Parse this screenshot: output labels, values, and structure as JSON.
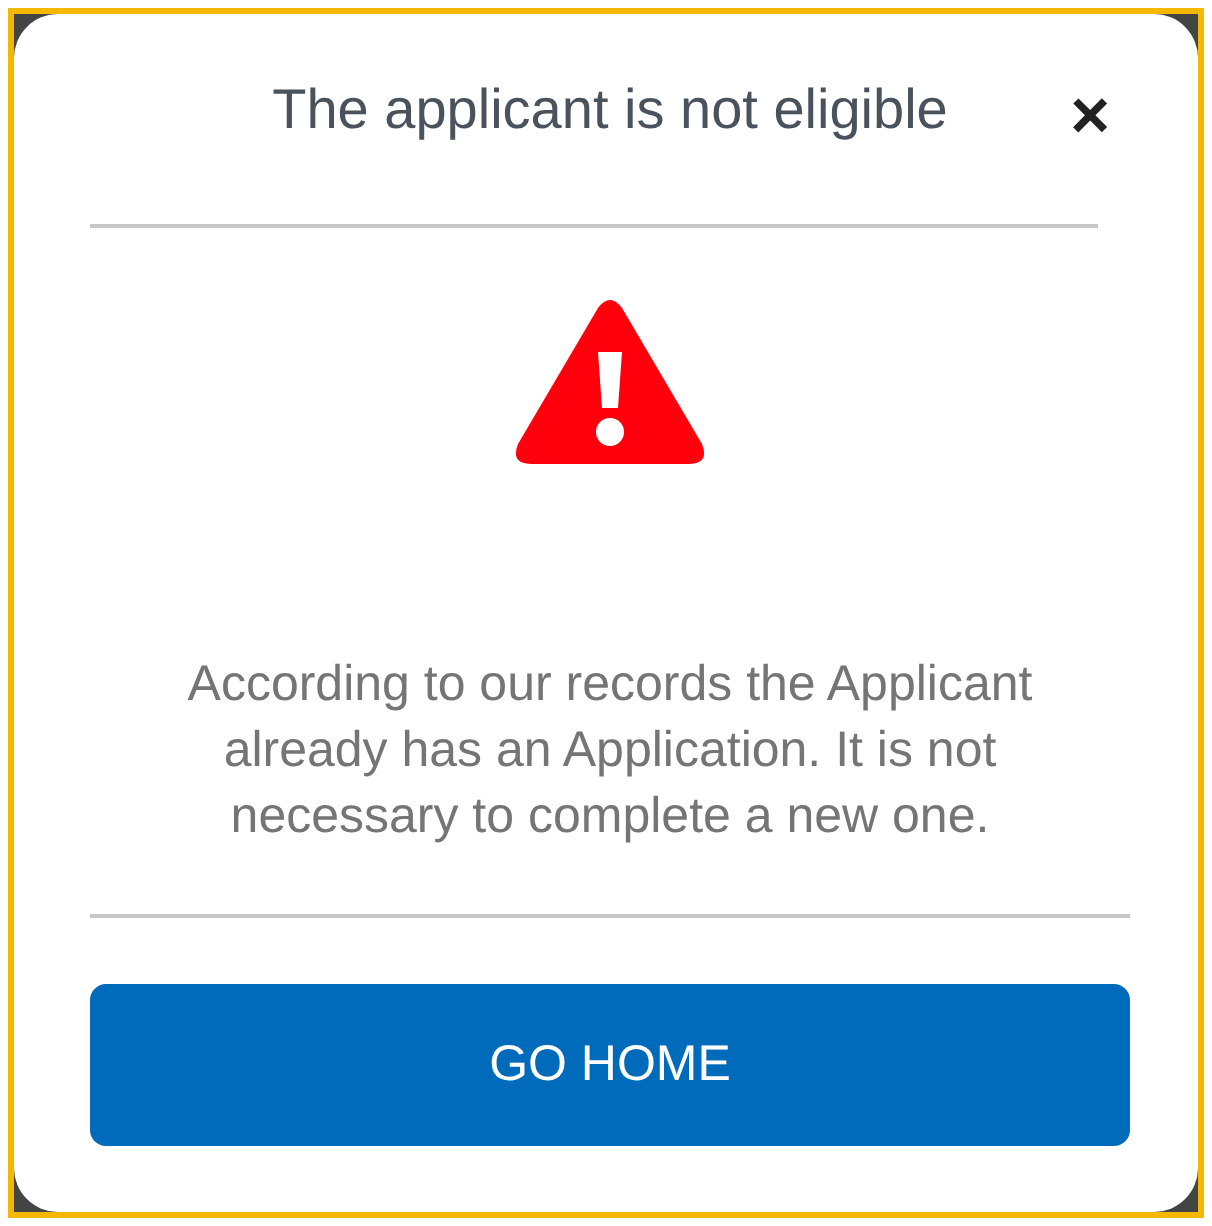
{
  "dialog": {
    "title": "The applicant is not eligible",
    "close": "×",
    "message": "According to our records the Applicant already has an Application. It is not necessary to complete a new one.",
    "buttons": [
      "GO HOME"
    ]
  }
}
